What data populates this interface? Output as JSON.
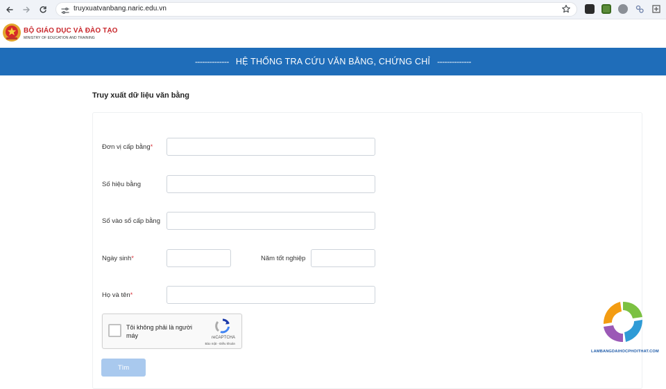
{
  "browser": {
    "url": "truyxuatvanbang.naric.edu.vn",
    "back_icon": "arrow-left-icon",
    "forward_icon": "arrow-right-icon",
    "reload_icon": "reload-icon",
    "site_info_icon": "tune-icon",
    "bookmark_icon": "star-icon"
  },
  "header": {
    "ministry_name": "BỘ GIÁO DỤC VÀ ĐÀO TẠO",
    "ministry_sub": "MINISTRY OF EDUCATION AND TRAINING",
    "emblem_icon": "national-emblem-icon"
  },
  "banner": {
    "dash_left": "--------------",
    "title": "HỆ THỐNG TRA CỨU VĂN BẰNG, CHỨNG CHỈ",
    "dash_right": "--------------"
  },
  "section": {
    "title": "Truy xuất dữ liệu văn bằng"
  },
  "form": {
    "issuer_label": "Đơn vị cấp bằng",
    "issuer_value": "",
    "degree_no_label": "Số hiệu bằng",
    "degree_no_value": "",
    "registry_no_label": "Số vào sổ cấp bằng",
    "registry_no_value": "",
    "dob_label": "Ngày sinh",
    "dob_value": "",
    "grad_year_label": "Năm tốt nghiệp",
    "grad_year_value": "",
    "fullname_label": "Họ và tên",
    "fullname_value": "",
    "required_mark": "*",
    "submit_label": "Tìm"
  },
  "captcha": {
    "text": "Tôi không phải là người máy",
    "brand": "reCAPTCHA",
    "terms": "Bảo mật - Điều khoản",
    "logo_icon": "recaptcha-icon"
  },
  "watermark": {
    "text": "LAMBANGDAIHOCPHOITHAT.COM",
    "logo_icon": "swirl-logo-icon"
  },
  "colors": {
    "banner": "#1f6db9",
    "ministry_red": "#c8262b",
    "submit": "#a9c9ee",
    "required": "#d9363e"
  }
}
